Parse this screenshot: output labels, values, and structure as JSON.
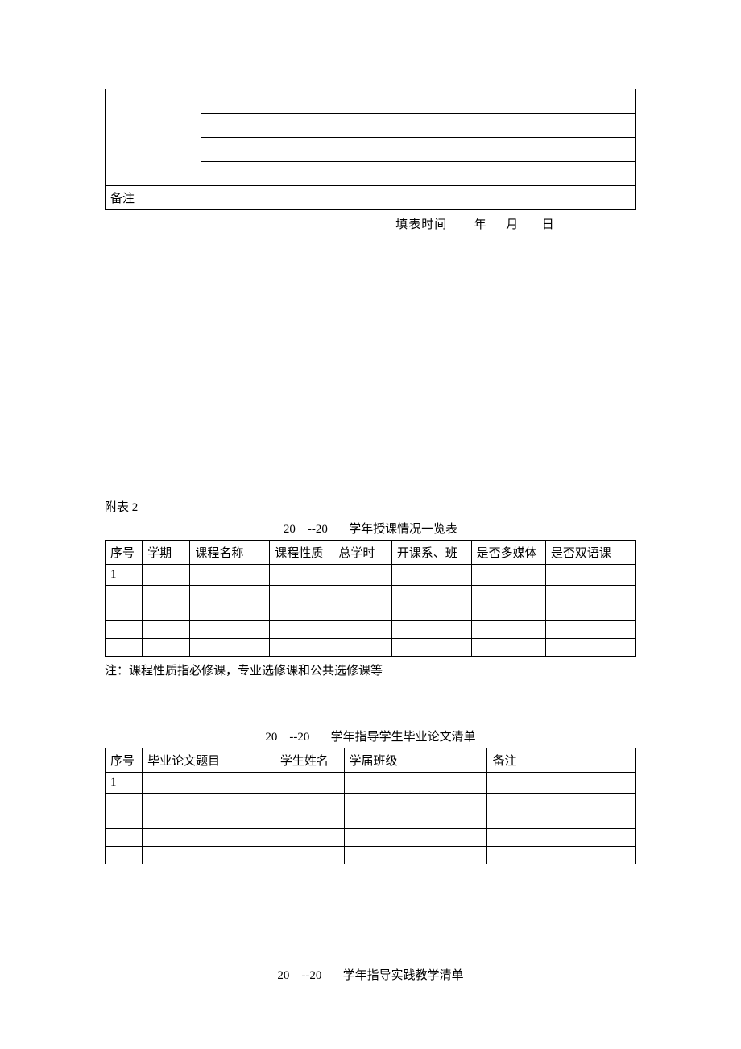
{
  "table1": {
    "remark_label": "备注"
  },
  "date_line": {
    "label": "填表时间",
    "year": "年",
    "month": "月",
    "day": "日"
  },
  "section2": {
    "label": "附表 2",
    "table2_title_prefix": "20",
    "table2_title_sep": "--20",
    "table2_title_suffix": "学年授课情况一览表",
    "table2_headers": [
      "序号",
      "学期",
      "课程名称",
      "课程性质",
      "总学时",
      "开课系、班",
      "是否多媒体",
      "是否双语课"
    ],
    "table2_rows": [
      {
        "seq": "1"
      },
      {
        "seq": ""
      },
      {
        "seq": ""
      },
      {
        "seq": ""
      },
      {
        "seq": ""
      }
    ],
    "note": "注：课程性质指必修课，专业选修课和公共选修课等",
    "table3_title_prefix": "20",
    "table3_title_sep": "--20",
    "table3_title_suffix": "学年指导学生毕业论文清单",
    "table3_headers": [
      "序号",
      "毕业论文题目",
      "学生姓名",
      "学届班级",
      "备注"
    ],
    "table3_rows": [
      {
        "seq": "1"
      },
      {
        "seq": ""
      },
      {
        "seq": ""
      },
      {
        "seq": ""
      },
      {
        "seq": ""
      }
    ],
    "table4_title_prefix": "20",
    "table4_title_sep": "--20",
    "table4_title_suffix": "学年指导实践教学清单"
  }
}
